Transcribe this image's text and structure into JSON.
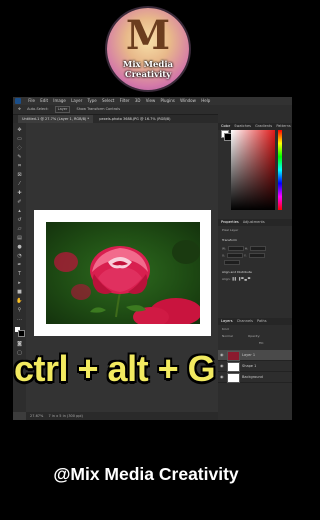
{
  "logo": {
    "letter": "M",
    "line1": "Mix Media",
    "line2": "Creativity"
  },
  "photoshop": {
    "menu": [
      "File",
      "Edit",
      "Image",
      "Layer",
      "Type",
      "Select",
      "Filter",
      "3D",
      "View",
      "Plugins",
      "Window",
      "Help"
    ],
    "options": {
      "auto_select": "Auto-Select:",
      "layer": "Layer",
      "transform": "Show Transform Controls"
    },
    "tabs": [
      "Untitled-1 @ 27.7% (Layer 1, RGB/8) *",
      "pexels-photo 3688.JPG @ 16.7% (RGB/8)"
    ],
    "status": [
      "27.67%",
      "7 in x 5 in (300 ppi)"
    ],
    "color_panel_tabs": [
      "Color",
      "Swatches",
      "Gradients",
      "Patterns"
    ],
    "properties_tabs": [
      "Properties",
      "Adjustments"
    ],
    "properties": {
      "kind": "Pixel Layer",
      "section_transform": "Transform",
      "w": "W:",
      "h": "H:",
      "x": "X:",
      "y": "Y:",
      "section_align": "Align and Distribute",
      "align": "Align:"
    },
    "layers_tabs": [
      "Layers",
      "Channels",
      "Paths"
    ],
    "layers_controls": {
      "kind": "Kind",
      "mode": "Normal",
      "opacity": "Opacity:",
      "fill": "Fill:"
    },
    "layers": [
      {
        "name": "Layer 1"
      },
      {
        "name": "Shape 1"
      },
      {
        "name": "Background"
      }
    ]
  },
  "overlay": {
    "shortcut": "ctrl + alt + G",
    "handle": "@Mix Media Creativity"
  },
  "colors": {
    "shortcut_text": "#f2ea60",
    "ps_dark": "#2d2d2d",
    "color_field_hue": "#e01a1a"
  }
}
